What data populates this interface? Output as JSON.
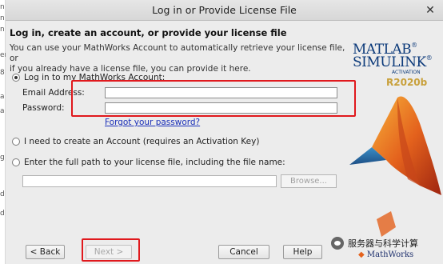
{
  "left_fragments": [
    "n",
    "n",
    "n",
    "er",
    "8",
    "a",
    "a",
    "g",
    "d",
    "d"
  ],
  "window": {
    "title": "Log in or Provide License File",
    "close_glyph": "✕"
  },
  "main": {
    "heading": "Log in, create an account, or provide your license file",
    "description_line1": "You can use your MathWorks Account to automatically retrieve your license file, or",
    "description_line2": "if you already have a license file, you can provide it here.",
    "login_option": {
      "label": "Log in to my MathWorks Account:",
      "selected": true,
      "email_label": "Email Address:",
      "email_value": "",
      "password_label": "Password:",
      "password_value": "",
      "forgot_link": "Forgot your password?"
    },
    "create_option": {
      "label": "I need to create an Account (requires an Activation Key)",
      "selected": false
    },
    "license_option": {
      "label": "Enter the full path to your license file, including the file name:",
      "selected": false,
      "path_value": "",
      "browse_label": "Browse..."
    }
  },
  "logo": {
    "line1": "MATLAB",
    "line2": "SIMULINK",
    "registered": "®",
    "activation": "ACTIVATION",
    "release": "R2020b"
  },
  "footer": {
    "back_label": "< Back",
    "next_label": "Next >",
    "next_enabled": false,
    "cancel_label": "Cancel",
    "help_label": "Help",
    "watermark_text": "服务器与科学计算",
    "mathworks_text": "MathWorks"
  },
  "colors": {
    "highlight_red": "#e0191d",
    "link_blue": "#1a2fb8",
    "logo_navy": "#0c3a7a",
    "release_gold": "#c8a03a"
  }
}
